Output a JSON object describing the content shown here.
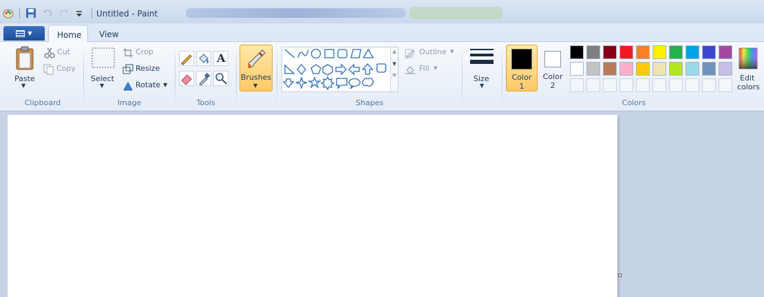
{
  "title_bar": {
    "title": "Untitled - Paint"
  },
  "tabs": [
    {
      "label": "Home"
    },
    {
      "label": "View"
    }
  ],
  "clipboard": {
    "paste": "Paste",
    "cut": "Cut",
    "copy": "Copy",
    "group_label": "Clipboard"
  },
  "image": {
    "select": "Select",
    "crop": "Crop",
    "resize": "Resize",
    "rotate": "Rotate",
    "group_label": "Image"
  },
  "tools": {
    "group_label": "Tools",
    "text_tool_glyph": "A"
  },
  "brushes": {
    "label": "Brushes"
  },
  "shapes": {
    "outline": "Outline",
    "fill": "Fill",
    "group_label": "Shapes"
  },
  "size": {
    "label": "Size"
  },
  "colors": {
    "color1_label": "Color",
    "color1_number": "1",
    "color2_label": "Color",
    "color2_number": "2",
    "edit_colors_line1": "Edit",
    "edit_colors_line2": "colors",
    "group_label": "Colors",
    "color1_value": "#000000",
    "color2_value": "#ffffff",
    "palette_row1": [
      "#000000",
      "#7f7f7f",
      "#880015",
      "#ed1c24",
      "#ff7f27",
      "#fff200",
      "#22b14c",
      "#00a2e8",
      "#3f48cc",
      "#a349a4"
    ],
    "palette_row2": [
      "#ffffff",
      "#c3c3c3",
      "#b97a57",
      "#ffaec9",
      "#ffc90e",
      "#efe4b0",
      "#b5e61d",
      "#99d9ea",
      "#7092be",
      "#c8bfe7"
    ]
  }
}
